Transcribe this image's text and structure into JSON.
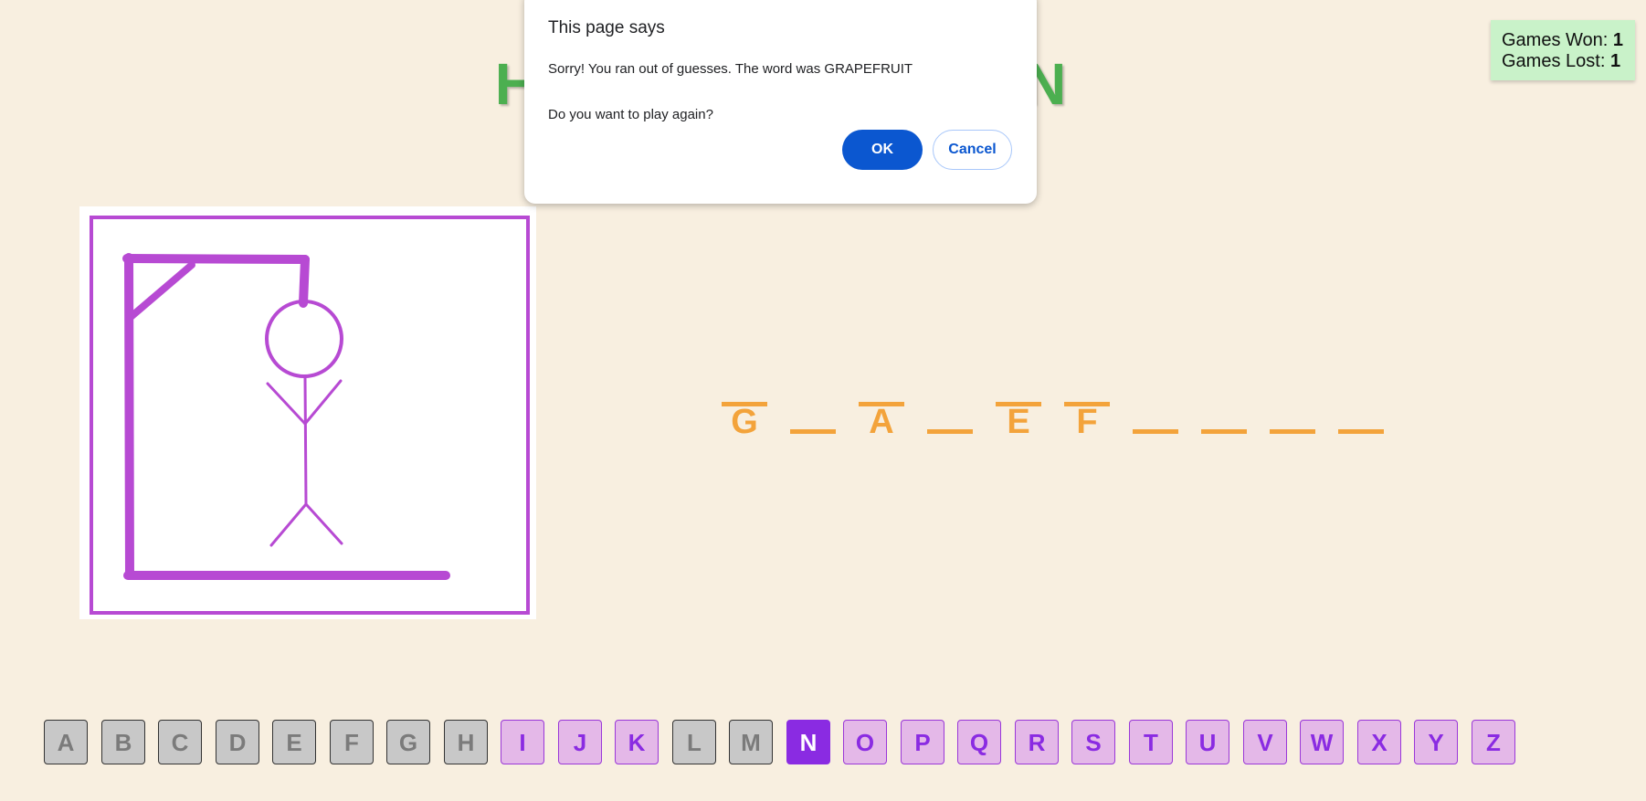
{
  "title": "HANGMAN EDITION",
  "score": {
    "won_label": "Games Won: ",
    "won_value": "1",
    "lost_label": "Games Lost: ",
    "lost_value": "1"
  },
  "word_slots": [
    "G",
    "",
    "A",
    "",
    "E",
    "F",
    "",
    "",
    "",
    ""
  ],
  "keyboard": {
    "keys": [
      "A",
      "B",
      "C",
      "D",
      "E",
      "F",
      "G",
      "H",
      "I",
      "J",
      "K",
      "L",
      "M",
      "N",
      "O",
      "P",
      "Q",
      "R",
      "S",
      "T",
      "U",
      "V",
      "W",
      "X",
      "Y",
      "Z"
    ],
    "used": [
      "A",
      "B",
      "C",
      "D",
      "E",
      "F",
      "G",
      "H",
      "L",
      "M"
    ],
    "active": "N"
  },
  "dialog": {
    "title": "This page says",
    "message": "Sorry! You ran out of guesses. The word was GRAPEFRUIT\nDo you want to play again?",
    "ok_label": "OK",
    "cancel_label": "Cancel"
  },
  "colors": {
    "title": "#4caf50",
    "drawing": "#b74ad3",
    "word": "#f3a33b",
    "key_available_bg": "#e4b8e8",
    "key_available_text": "#8a2be2",
    "key_used_bg": "#c8c8c8",
    "key_active_bg": "#8a2be2",
    "score_bg": "#c9f2c9",
    "dialog_ok": "#0b57d0"
  }
}
